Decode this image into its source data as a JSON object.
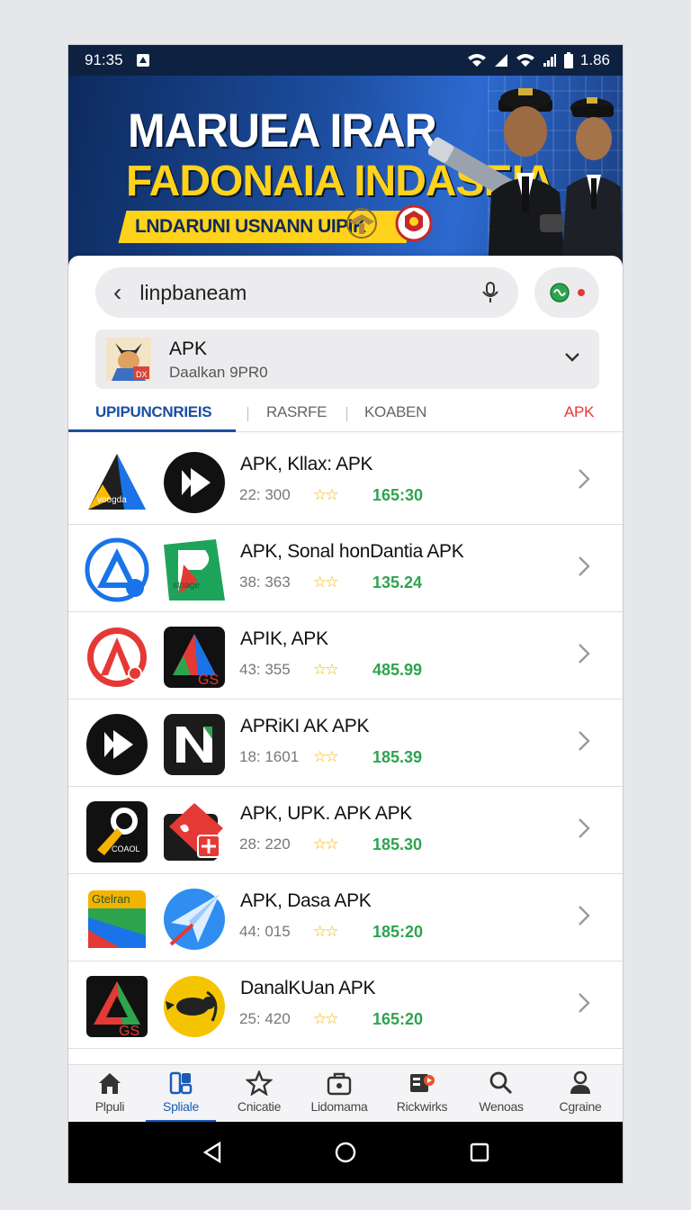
{
  "status_bar": {
    "time": "91:35",
    "battery_text": "1.86"
  },
  "banner": {
    "title_line1": "MARUEA IRAR",
    "title_line2": "FADONAIA INDASEIA",
    "ribbon_text": "LNDARUNI USNANN UIPIK",
    "colors": {
      "title2": "#ffd21c",
      "ribbon": "#ffd21c",
      "background": "#1c4d9e"
    }
  },
  "search": {
    "query": "linpbaneam"
  },
  "filter": {
    "title": "APK",
    "subtitle": "Daalkan 9PR0"
  },
  "tabs": [
    {
      "label": "UPIPUNCNRIEIS",
      "active": true
    },
    {
      "label": "RASRFE",
      "active": false
    },
    {
      "label": "KOABEN",
      "active": false
    },
    {
      "label": "APK",
      "active": false
    }
  ],
  "apps": [
    {
      "name": "APK, Kllax: APK",
      "meta": "22: 300",
      "stars": "☆☆",
      "price": "165:30",
      "icon1": "blue-triangle-app-icon",
      "icon2": "play-button-app-icon"
    },
    {
      "name": "APK, Sonal honDantia APK",
      "meta": "38: 363",
      "stars": "☆☆",
      "price": "135.24",
      "icon1": "blue-circle-a-app-icon",
      "icon2": "green-square-app-icon"
    },
    {
      "name": "APIK, APK",
      "meta": "43: 355",
      "stars": "☆☆",
      "price": "485.99",
      "icon1": "red-circle-a-app-icon",
      "icon2": "gs-triangle-app-icon"
    },
    {
      "name": "APRiKI AK APK",
      "meta": "18: 1601",
      "stars": "☆☆",
      "price": "185.39",
      "icon1": "play-circle-app-icon",
      "icon2": "n-letter-app-icon"
    },
    {
      "name": "APK, UPK. APK APK",
      "meta": "28: 220",
      "stars": "☆☆",
      "price": "185.30",
      "icon1": "key-app-icon",
      "icon2": "red-tag-app-icon"
    },
    {
      "name": "APK, Dasa APK",
      "meta": "44: 015",
      "stars": "☆☆",
      "price": "185:20",
      "icon1": "colorful-book-app-icon",
      "icon2": "plane-app-icon"
    },
    {
      "name": "DanalKUan APK",
      "meta": "25: 420",
      "stars": "☆☆",
      "price": "165:20",
      "icon1": "gs-triangle-dark-app-icon",
      "icon2": "yellow-circle-app-icon"
    }
  ],
  "bottom_nav": [
    {
      "label": "Plpuli",
      "icon": "home-icon"
    },
    {
      "label": "Spliale",
      "icon": "apps-icon",
      "active": true
    },
    {
      "label": "Cnicatie",
      "icon": "star-icon"
    },
    {
      "label": "Lidomama",
      "icon": "briefcase-icon"
    },
    {
      "label": "Rickwirks",
      "icon": "media-icon"
    },
    {
      "label": "Wenoas",
      "icon": "search-icon"
    },
    {
      "label": "Cgraine",
      "icon": "person-icon"
    }
  ]
}
